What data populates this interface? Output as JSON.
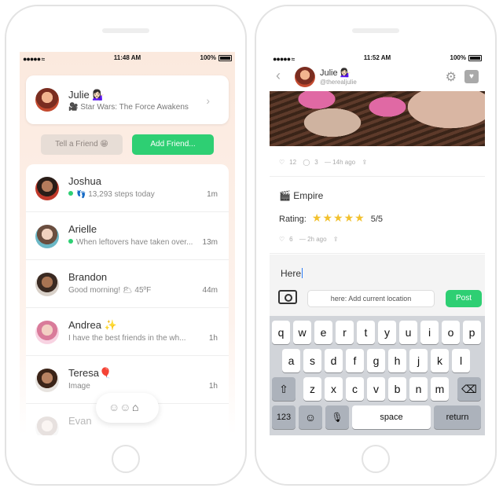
{
  "status_bar": {
    "signal": "●●●●● ",
    "wifi": "≈",
    "battery_pct": "100%"
  },
  "left_screen": {
    "time": "11:48 AM",
    "profile": {
      "name": "Julie 💁🏻‍♀️",
      "status": "🎥 Star Wars: The Force Awakens"
    },
    "tell_friend_label": "Tell a Friend 😁",
    "add_friend_label": "Add Friend...",
    "friends": [
      {
        "name": "Joshua",
        "activity": "👣 13,293 steps today",
        "time": "1m",
        "online": true
      },
      {
        "name": "Arielle",
        "activity": "When leftovers have taken over...",
        "time": "13m",
        "online": true
      },
      {
        "name": "Brandon",
        "activity": "Good morning! 🌥 45ºF",
        "time": "44m",
        "online": false
      },
      {
        "name": "Andrea ✨",
        "activity": "I have the best friends in the wh...",
        "time": "1h",
        "online": false
      },
      {
        "name": "Teresa🎈",
        "activity": "Image",
        "time": "1h",
        "online": false
      },
      {
        "name": "Evan",
        "activity": "",
        "time": "",
        "online": false
      }
    ]
  },
  "right_screen": {
    "time": "11:52 AM",
    "chat": {
      "name": "Julie 💁🏻‍♀️",
      "handle": "@therealjulie"
    },
    "post1_meta": {
      "likes": "12",
      "comments": "3",
      "time": "— 14h ago"
    },
    "post2": {
      "title": "🎬 Empire",
      "rating_label": "Rating:",
      "stars": "★★★★★",
      "rating_value": "5/5"
    },
    "post2_meta": {
      "likes": "6",
      "time": "— 2h ago"
    },
    "compose_text": "Here",
    "location_label": "here: Add current location",
    "post_label": "Post",
    "keyboard": {
      "row1": [
        "q",
        "w",
        "e",
        "r",
        "t",
        "y",
        "u",
        "i",
        "o",
        "p"
      ],
      "row2": [
        "a",
        "s",
        "d",
        "f",
        "g",
        "h",
        "j",
        "k",
        "l"
      ],
      "row3": [
        "z",
        "x",
        "c",
        "v",
        "b",
        "n",
        "m"
      ],
      "shift": "⇧",
      "backspace": "⌫",
      "numbers": "123",
      "emoji": "☺",
      "mic": "🎙",
      "space": "space",
      "return": "return"
    }
  }
}
